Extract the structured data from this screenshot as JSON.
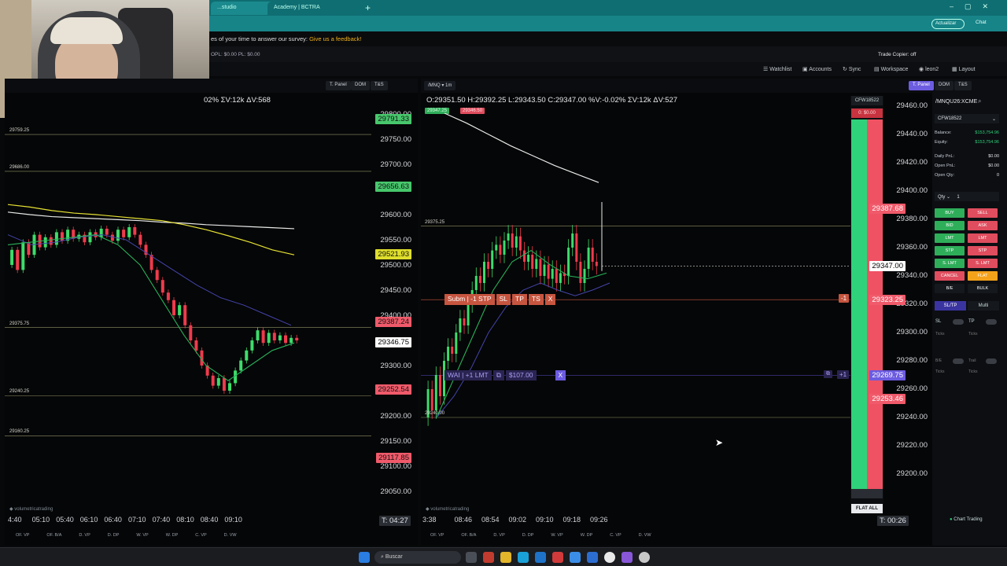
{
  "browser": {
    "tabs": [
      "...studio",
      "Academy | BCTRA"
    ],
    "update_label": "Actualizar",
    "chat_label": "Chat"
  },
  "survey": {
    "text": "es of your time to answer our survey:",
    "link": "Give us a feedback!"
  },
  "pnl": {
    "text": "OPL: $0.00 PL: $0.00",
    "trade_copier": "Trade Copier: off"
  },
  "toolbar": {
    "watchlist": "Watchlist",
    "accounts": "Accounts",
    "sync": "Sync",
    "workspace": "Workspace",
    "user": "leon2",
    "layout": "Layout"
  },
  "left_chart": {
    "stats": "02%  ΣV:12k  ΔV:568",
    "buttons": [
      "T. Panel",
      "DOM",
      "T&S"
    ],
    "price_labels": [
      "29800.00",
      "29750.00",
      "29700.00",
      "29650.00",
      "29600.00",
      "29550.00",
      "29500.00",
      "29450.00",
      "29400.00",
      "29350.00",
      "29300.00",
      "29250.00",
      "29200.00",
      "29150.00",
      "29100.00",
      "29050.00"
    ],
    "price_boxes": [
      {
        "text": "29791.33",
        "color": "#47c76c"
      },
      {
        "text": "29656.63",
        "color": "#47c76c"
      },
      {
        "text": "29521.93",
        "color": "#dede2c"
      },
      {
        "text": "29387.24",
        "color": "#f05a6a"
      },
      {
        "text": "29346.75",
        "color": "#ffffff"
      },
      {
        "text": "29252.54",
        "color": "#f05a6a"
      },
      {
        "text": "29117.85",
        "color": "#f05a6a"
      }
    ],
    "hlevels": [
      "29759.25",
      "29686.00",
      "29375.75",
      "29240.25",
      "29160.25"
    ],
    "time_labels": [
      "4:40",
      "05:10",
      "05:40",
      "06:10",
      "06:40",
      "07:10",
      "07:40",
      "08:10",
      "08:40",
      "09:10"
    ],
    "timer": "T: 04:27",
    "bottom_tabs": [
      "OF. VP",
      "OF. B/A",
      "D. VP",
      "D. DP",
      "W. VP",
      "W. DP",
      "C. VP",
      "D. VW"
    ]
  },
  "right_chart": {
    "symbol": "/MNQ",
    "interval": "1m",
    "ohlc": "O:29351.50  H:29392.25  L:29343.50  C:29347.00  %V:-0.02%  ΣV:12k  ΔV:527",
    "bid_ask": [
      "29347.25",
      "29346.50"
    ],
    "price_labels": [
      "29460.00",
      "29440.00",
      "29420.00",
      "29400.00",
      "29380.00",
      "29360.00",
      "29340.00",
      "29320.00",
      "29300.00",
      "29280.00",
      "29260.00",
      "29240.00",
      "29220.00",
      "29200.00"
    ],
    "price_boxes": [
      {
        "text": "29387.68",
        "color": "#f05a6a"
      },
      {
        "text": "29347.00",
        "color": "#ffffff"
      },
      {
        "text": "29323.25",
        "color": "#f05a6a"
      },
      {
        "text": "29269.75",
        "color": "#6c5ce0"
      },
      {
        "text": "29253.46",
        "color": "#f05a6a"
      }
    ],
    "hlevels": [
      "29375.25",
      "29240.00"
    ],
    "order_bar": {
      "submit": "Subm | -1 STP",
      "sl": "SL",
      "tp": "TP",
      "ts": "TS",
      "close": "X",
      "qty": "-1"
    },
    "limit_bar": {
      "label": "WAI | +1 LMT",
      "icon": "⧉",
      "price": "$107.00",
      "close": "X",
      "qty": "+1"
    },
    "account_id": "CFW18522",
    "pl": "0: $0.00",
    "flat_all": "FLAT ALL",
    "time_labels": [
      "3:38",
      "08:46",
      "08:54",
      "09:02",
      "09:10",
      "09:18",
      "09:26"
    ],
    "timer": "T: 00:26",
    "bottom_tabs": [
      "OF. VP",
      "OF. B/A",
      "D. VP",
      "D. DP",
      "W. VP",
      "W. DP",
      "C. VP",
      "D. VW"
    ]
  },
  "trade_panel": {
    "buttons": [
      "T. Panel",
      "DOM",
      "T&S"
    ],
    "symbol": "/MNQU26:XCME",
    "account": "CFW18522",
    "rows": [
      {
        "label": "Balance:",
        "value": "$153,754.96"
      },
      {
        "label": "Equity:",
        "value": "$153,754.96"
      },
      {
        "label": "Daily PnL:",
        "value": "$0.00"
      },
      {
        "label": "Open PnL:",
        "value": "$0.00"
      },
      {
        "label": "Open Qty:",
        "value": "0"
      }
    ],
    "qty_label": "Qty",
    "qty_value": "1",
    "order_buttons": [
      [
        "BUY",
        "SELL"
      ],
      [
        "BID",
        "ASK"
      ],
      [
        "LMT",
        "LMT"
      ],
      [
        "STP",
        "STP"
      ],
      [
        "S. LMT",
        "S. LMT"
      ],
      [
        "CANCEL",
        "FLAT"
      ],
      [
        "B/E",
        "BULK"
      ]
    ],
    "tabs": [
      "SL/TP",
      "Multi"
    ],
    "sl": "SL",
    "tp": "TP",
    "ticks": "Ticks",
    "be": "B/E",
    "trail": "Trail",
    "footer": "Chart Trading"
  },
  "taskbar": {
    "search": "Buscar"
  }
}
